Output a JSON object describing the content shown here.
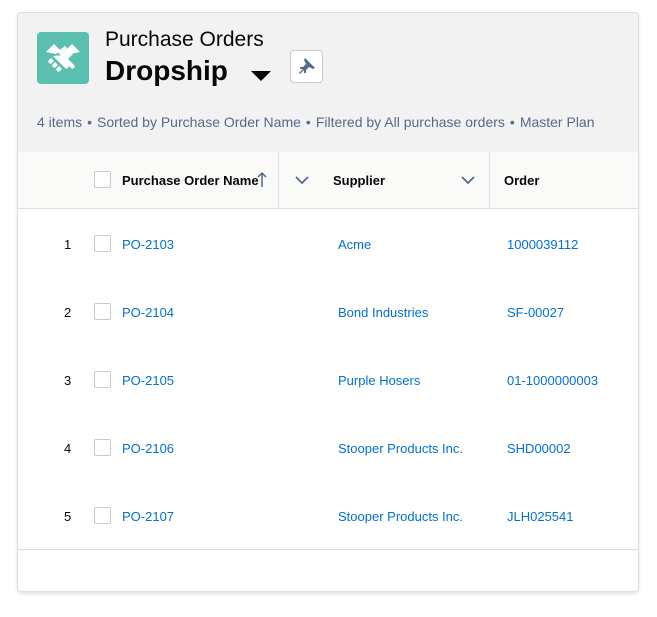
{
  "header": {
    "object_label": "Purchase Orders",
    "list_view_name": "Dropship",
    "meta": {
      "items": "4 items",
      "sorted": "Sorted by Purchase Order Name",
      "filtered": "Filtered by All purchase orders",
      "plan": "Master Plan",
      "separator": "•"
    }
  },
  "table": {
    "columns": {
      "name": "Purchase Order Name",
      "supplier": "Supplier",
      "order": "Order"
    },
    "rows": [
      {
        "num": "1",
        "name": "PO-2103",
        "supplier": "Acme",
        "order": "1000039112"
      },
      {
        "num": "2",
        "name": "PO-2104",
        "supplier": "Bond Industries",
        "order": "SF-00027"
      },
      {
        "num": "3",
        "name": "PO-2105",
        "supplier": "Purple Hosers",
        "order": "01-1000000003"
      },
      {
        "num": "4",
        "name": "PO-2106",
        "supplier": "Stooper Products Inc.",
        "order": "SHD00002"
      },
      {
        "num": "5",
        "name": "PO-2107",
        "supplier": "Stooper Products Inc.",
        "order": "JLH025541"
      }
    ]
  },
  "colors": {
    "app_icon": "#5bbfb0",
    "link": "#0070d2",
    "header_bg": "#f3f2f2"
  },
  "icons": [
    "handshake-icon",
    "triangle-down-icon",
    "pin-icon",
    "sort-arrow-up-icon",
    "chevron-down-icon"
  ]
}
